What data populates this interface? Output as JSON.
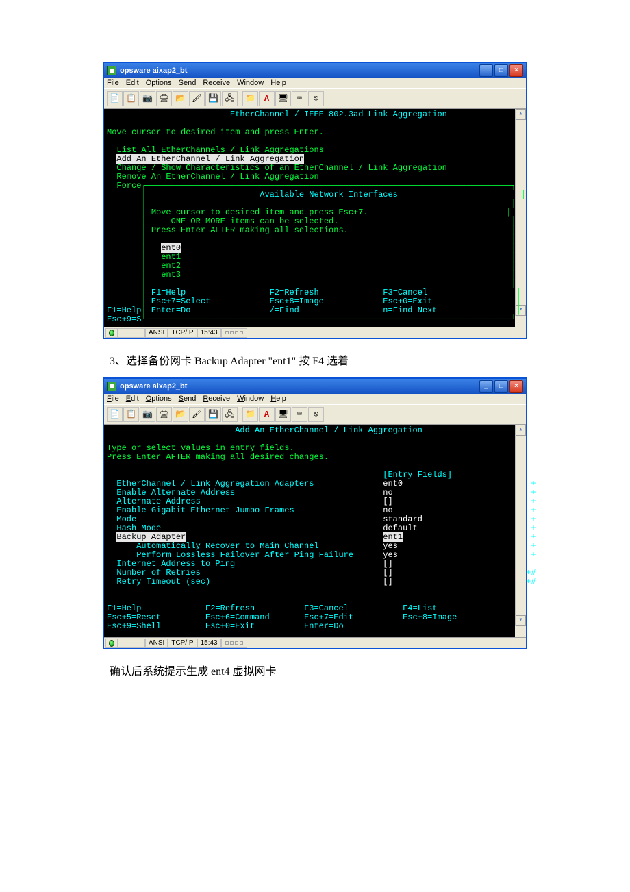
{
  "doc": {
    "step3": "3、选择备份网卡 Backup Adapter \"ent1\" 按 F4 选着",
    "confirm": "确认后系统提示生成 ent4 虚拟网卡"
  },
  "window": {
    "title": "opsware aixap2_bt",
    "menu": {
      "file": "File",
      "edit": "Edit",
      "options": "Options",
      "send": "Send",
      "receive": "Receive",
      "window": "Window",
      "help": "Help"
    },
    "status": {
      "mode": "ANSI",
      "proto": "TCP/IP",
      "time": "15:43"
    }
  },
  "term1": {
    "title": "EtherChannel / IEEE 802.3ad Link Aggregation",
    "instr": "Move cursor to desired item and press Enter.",
    "m1": "List All EtherChannels / Link Aggregations",
    "m2": "Add An EtherChannel / Link Aggregation",
    "m3": "Change / Show Characteristics of an EtherChannel / Link Aggregation",
    "m4": "Remove An EtherChannel / Link Aggregation",
    "m5": "Force",
    "popup_title": "Available Network Interfaces",
    "p1": "Move cursor to desired item and press Esc+7.",
    "p2": "ONE OR MORE items can be selected.",
    "p3": "Press Enter AFTER making all selections.",
    "opt0": "ent0",
    "opt1": "ent1",
    "opt2": "ent2",
    "opt3": "ent3",
    "k": {
      "f1": "F1=Help",
      "f2": "F2=Refresh",
      "f3": "F3=Cancel",
      "e7": "Esc+7=Select",
      "e8": "Esc+8=Image",
      "e0": "Esc+0=Exit",
      "enter": "Enter=Do",
      "find": "/=Find",
      "next": "n=Find Next"
    },
    "outer": {
      "f1": "F1=Help",
      "esc9": "Esc+9=S"
    }
  },
  "term2": {
    "title": "Add An EtherChannel / Link Aggregation",
    "l1": "Type or select values in entry fields.",
    "l2": "Press Enter AFTER making all desired changes.",
    "entry_hdr": "[Entry Fields]",
    "rows": {
      "r1l": "EtherChannel / Link Aggregation Adapters",
      "r1v": "ent0",
      "r2l": "Enable Alternate Address",
      "r2v": "no",
      "r3l": "Alternate Address",
      "r3v": "[]",
      "r4l": "Enable Gigabit Ethernet Jumbo Frames",
      "r4v": "no",
      "r5l": "Mode",
      "r5v": "standard",
      "r6l": "Hash Mode",
      "r6v": "default",
      "r7l": "Backup Adapter",
      "r7v": "ent1",
      "r8l": "Automatically Recover to Main Channel",
      "r8v": "yes",
      "r9l": "Perform Lossless Failover After Ping Failure",
      "r9v": "yes",
      "r10l": "Internet Address to Ping",
      "r10v": "[]",
      "r11l": "Number of Retries",
      "r11v": "[]",
      "r12l": "Retry Timeout (sec)",
      "r12v": "[]"
    },
    "k": {
      "f1": "F1=Help",
      "f2": "F2=Refresh",
      "f3": "F3=Cancel",
      "f4": "F4=List",
      "e5": "Esc+5=Reset",
      "e6": "Esc+6=Command",
      "e7": "Esc+7=Edit",
      "e8": "Esc+8=Image",
      "e9": "Esc+9=Shell",
      "e0": "Esc+0=Exit",
      "enter": "Enter=Do"
    }
  }
}
